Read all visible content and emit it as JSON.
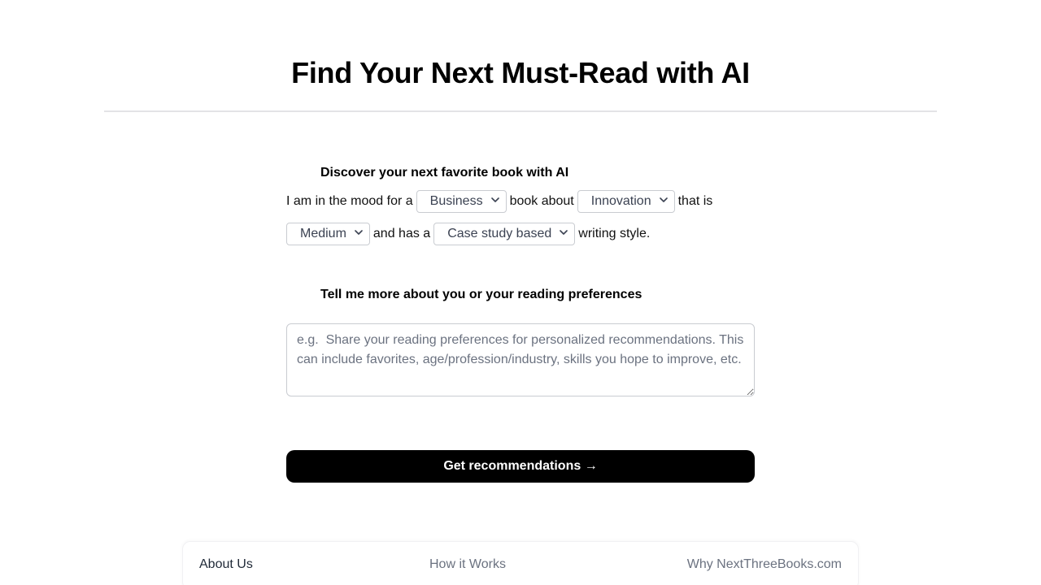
{
  "header": {
    "title": "Find Your Next Must-Read with AI"
  },
  "discover": {
    "heading": "Discover your next favorite book with AI",
    "text_before_genre": "I am in the mood for a",
    "genre": "Business",
    "text_before_topic": "book about",
    "topic": "Innovation",
    "text_before_length": "that is",
    "length": "Medium",
    "text_before_style": "and has a",
    "style": "Case study based",
    "text_after_style": "writing style."
  },
  "preferences": {
    "heading": "Tell me more about you or your reading preferences",
    "placeholder": "e.g.  Share your reading preferences for personalized recommendations. This can include favorites, age/profession/industry, skills you hope to improve, etc.",
    "value": ""
  },
  "cta": {
    "label": "Get recommendations →"
  },
  "footer": {
    "links": [
      "About Us",
      "How it Works",
      "Why NextThreeBooks.com"
    ]
  },
  "colors": {
    "cta_background": "#000000",
    "divider": "#e3e3e6",
    "select_border": "#c9ccd1"
  },
  "icons": {
    "select_chevron": "chevron-down-icon"
  }
}
